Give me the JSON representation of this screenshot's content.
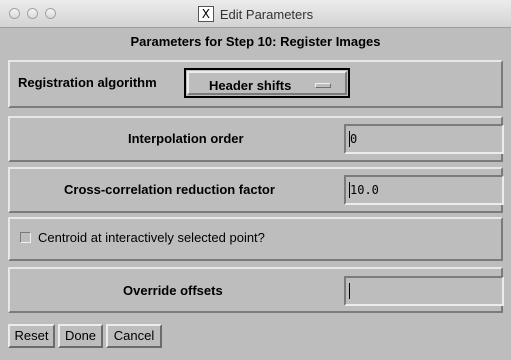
{
  "window": {
    "title": "Edit Parameters"
  },
  "dialog": {
    "heading": "Parameters for Step 10: Register Images",
    "registration": {
      "label": "Registration algorithm",
      "value": "Header shifts"
    },
    "interpolation": {
      "label": "Interpolation order",
      "value": "0"
    },
    "cross_corr": {
      "label": "Cross-correlation reduction factor",
      "value": "10.0"
    },
    "centroid": {
      "label": "Centroid at interactively selected point?",
      "checked": false
    },
    "override": {
      "label": "Override offsets",
      "value": ""
    }
  },
  "buttons": {
    "reset": "Reset",
    "done": "Done",
    "cancel": "Cancel"
  }
}
